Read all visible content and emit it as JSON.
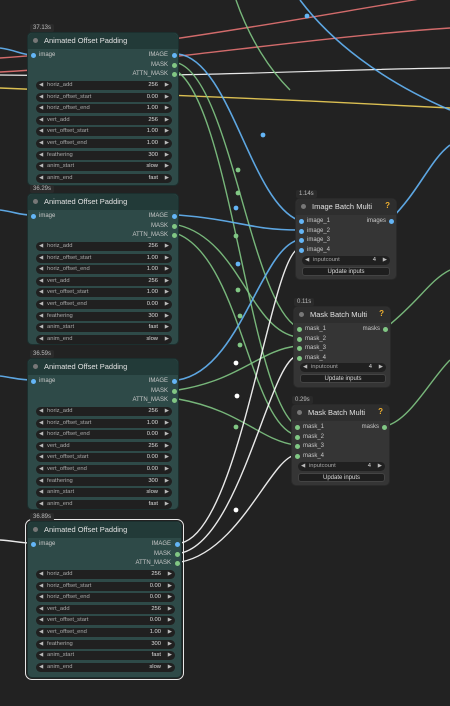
{
  "colors": {
    "image_port": "#64b5f6",
    "mask_port": "#81c784",
    "wire_white": "#ffffff",
    "wire_red": "#e57373",
    "wire_yellow": "#f0d058"
  },
  "offset_nodes": [
    {
      "time": "37.13s",
      "title": "Animated Offset Padding",
      "input": "image",
      "outputs": [
        "IMAGE",
        "MASK",
        "ATTN_MASK"
      ],
      "widgets": [
        [
          "horiz_add",
          "256"
        ],
        [
          "horiz_offset_start",
          "0.00"
        ],
        [
          "horiz_offset_end",
          "1.00"
        ],
        [
          "vert_add",
          "256"
        ],
        [
          "vert_offset_start",
          "1.00"
        ],
        [
          "vert_offset_end",
          "1.00"
        ],
        [
          "feathering",
          "300"
        ],
        [
          "anim_start",
          "slow"
        ],
        [
          "anim_end",
          "fast"
        ]
      ]
    },
    {
      "time": "36.29s",
      "title": "Animated Offset Padding",
      "input": "image",
      "outputs": [
        "IMAGE",
        "MASK",
        "ATTN_MASK"
      ],
      "widgets": [
        [
          "horiz_add",
          "256"
        ],
        [
          "horiz_offset_start",
          "1.00"
        ],
        [
          "horiz_offset_end",
          "1.00"
        ],
        [
          "vert_add",
          "256"
        ],
        [
          "vert_offset_start",
          "1.00"
        ],
        [
          "vert_offset_end",
          "0.00"
        ],
        [
          "feathering",
          "300"
        ],
        [
          "anim_start",
          "fast"
        ],
        [
          "anim_end",
          "slow"
        ]
      ]
    },
    {
      "time": "36.59s",
      "title": "Animated Offset Padding",
      "input": "image",
      "outputs": [
        "IMAGE",
        "MASK",
        "ATTN_MASK"
      ],
      "widgets": [
        [
          "horiz_add",
          "256"
        ],
        [
          "horiz_offset_start",
          "1.00"
        ],
        [
          "horiz_offset_end",
          "0.00"
        ],
        [
          "vert_add",
          "256"
        ],
        [
          "vert_offset_start",
          "0.00"
        ],
        [
          "vert_offset_end",
          "0.00"
        ],
        [
          "feathering",
          "300"
        ],
        [
          "anim_start",
          "slow"
        ],
        [
          "anim_end",
          "fast"
        ]
      ]
    },
    {
      "time": "36.89s",
      "title": "Animated Offset Padding",
      "input": "image",
      "outputs": [
        "IMAGE",
        "MASK",
        "ATTN_MASK"
      ],
      "widgets": [
        [
          "horiz_add",
          "256"
        ],
        [
          "horiz_offset_start",
          "0.00"
        ],
        [
          "horiz_offset_end",
          "0.00"
        ],
        [
          "vert_add",
          "256"
        ],
        [
          "vert_offset_start",
          "0.00"
        ],
        [
          "vert_offset_end",
          "1.00"
        ],
        [
          "feathering",
          "300"
        ],
        [
          "anim_start",
          "fast"
        ],
        [
          "anim_end",
          "slow"
        ]
      ]
    }
  ],
  "batch_nodes": [
    {
      "time": "1.14s",
      "title": "Image Batch Multi",
      "help": "?",
      "inputs": [
        "image_1",
        "image_2",
        "image_3",
        "image_4"
      ],
      "output": "images",
      "count_label": "inputcount",
      "count_value": "4",
      "button": "Update inputs",
      "kind": "image"
    },
    {
      "time": "0.11s",
      "title": "Mask Batch Multi",
      "help": "?",
      "inputs": [
        "mask_1",
        "mask_2",
        "mask_3",
        "mask_4"
      ],
      "output": "masks",
      "count_label": "inputcount",
      "count_value": "4",
      "button": "Update inputs",
      "kind": "mask"
    },
    {
      "time": "0.29s",
      "title": "Mask Batch Multi",
      "help": "?",
      "inputs": [
        "mask_1",
        "mask_2",
        "mask_3",
        "mask_4"
      ],
      "output": "masks",
      "count_label": "inputcount",
      "count_value": "4",
      "button": "Update inputs",
      "kind": "mask"
    }
  ]
}
